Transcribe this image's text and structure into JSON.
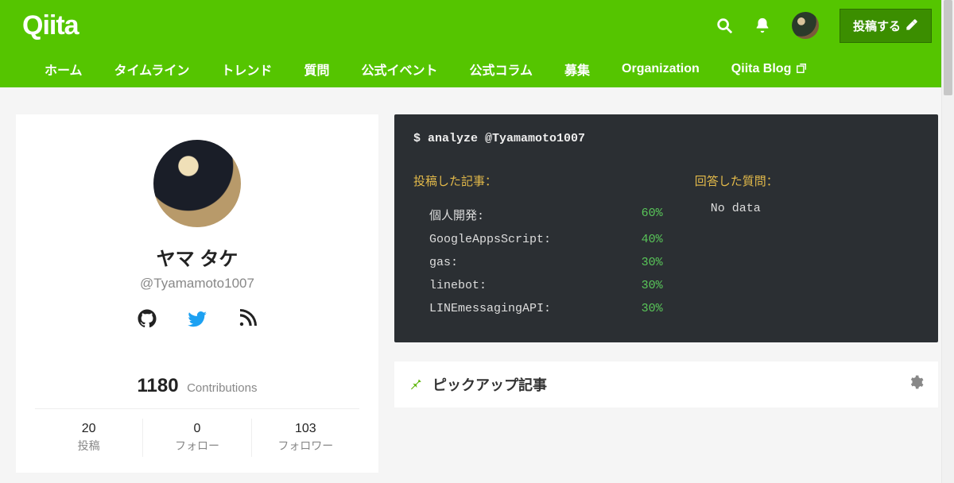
{
  "header": {
    "logo_text": "Qiita",
    "post_button": "投稿する",
    "nav": [
      "ホーム",
      "タイムライン",
      "トレンド",
      "質問",
      "公式イベント",
      "公式コラム",
      "募集",
      "Organization",
      "Qiita Blog"
    ]
  },
  "profile": {
    "display_name": "ヤマ タケ",
    "handle": "@Tyamamoto1007",
    "contributions_value": "1180",
    "contributions_label": "Contributions",
    "stats": {
      "posts_value": "20",
      "posts_label": "投稿",
      "follow_value": "0",
      "follow_label": "フォロー",
      "followers_value": "103",
      "followers_label": "フォロワー"
    },
    "socials": {
      "github": "github-icon",
      "twitter": "twitter-icon",
      "rss": "rss-icon"
    }
  },
  "terminal": {
    "prompt": "$ analyze @Tyamamoto1007",
    "articles_heading": "投稿した記事：",
    "answers_heading": "回答した質問：",
    "no_data": "No data",
    "tags": [
      {
        "name": "個人開発:",
        "pct": "60%"
      },
      {
        "name": "GoogleAppsScript:",
        "pct": "40%"
      },
      {
        "name": "gas:",
        "pct": "30%"
      },
      {
        "name": "linebot:",
        "pct": "30%"
      },
      {
        "name": "LINEmessagingAPI:",
        "pct": "30%"
      }
    ]
  },
  "pickup": {
    "title": "ピックアップ記事"
  }
}
